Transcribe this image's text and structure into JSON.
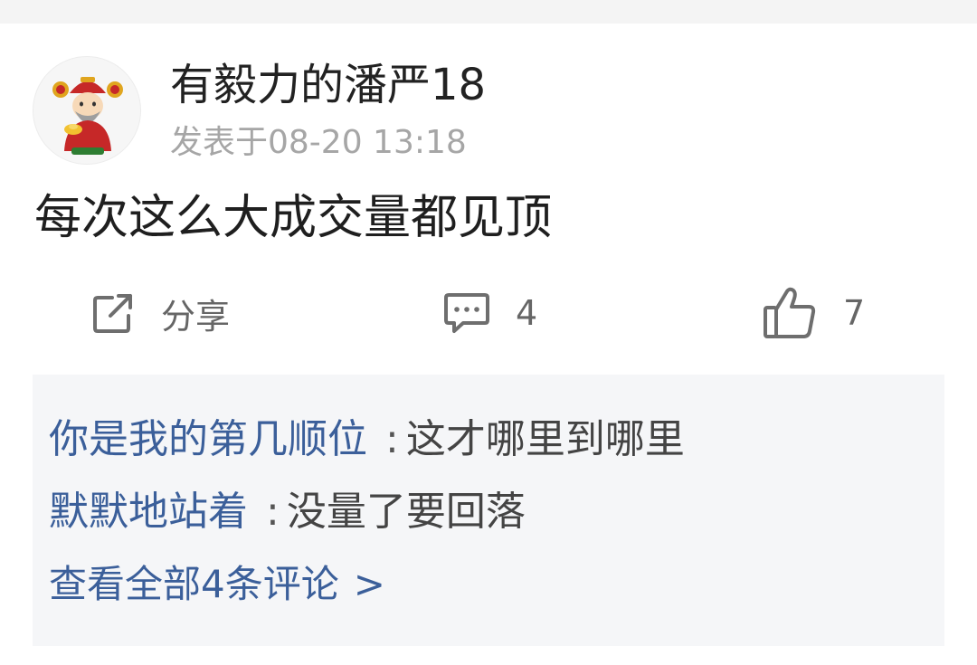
{
  "post": {
    "username": "有毅力的潘严18",
    "time": "发表于08-20 13:18",
    "content": "每次这么大成交量都见顶"
  },
  "actions": {
    "share_label": "分享",
    "share_icon": "share-icon",
    "comment_count": "4",
    "comment_icon": "comment-icon",
    "like_count": "7",
    "like_icon": "thumbs-up-icon"
  },
  "comments": {
    "items": [
      {
        "author": "你是我的第几顺位",
        "separator": ":",
        "text": "这才哪里到哪里"
      },
      {
        "author": "默默地站着",
        "separator": ":",
        "text": "没量了要回落"
      }
    ],
    "view_all": "查看全部4条评论",
    "view_all_chevron": ">"
  },
  "colors": {
    "link_blue": "#3b5f9a",
    "muted_gray": "#a6a6a6",
    "comment_bg": "#f5f6f8"
  }
}
